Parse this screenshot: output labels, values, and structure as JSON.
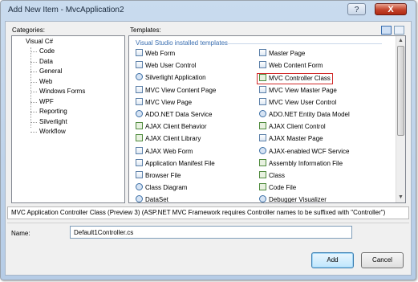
{
  "window": {
    "title": "Add New Item - MvcApplication2",
    "help_glyph": "?",
    "close_glyph": "X"
  },
  "categories": {
    "label": "Categories:",
    "root": "Visual C#",
    "items": [
      "Code",
      "Data",
      "General",
      "Web",
      "Windows Forms",
      "WPF",
      "Reporting",
      "Silverlight",
      "Workflow"
    ]
  },
  "templates": {
    "label": "Templates:",
    "group_header": "Visual Studio installed templates",
    "left": [
      {
        "label": "Web Form",
        "icon": "doc"
      },
      {
        "label": "Web User Control",
        "icon": "doc"
      },
      {
        "label": "Silverlight Application",
        "icon": "gear"
      },
      {
        "label": "MVC View Content Page",
        "icon": "doc"
      },
      {
        "label": "MVC View Page",
        "icon": "doc"
      },
      {
        "label": "ADO.NET Data Service",
        "icon": "gear"
      },
      {
        "label": "AJAX Client Behavior",
        "icon": "code"
      },
      {
        "label": "AJAX Client Library",
        "icon": "code"
      },
      {
        "label": "AJAX Web Form",
        "icon": "doc"
      },
      {
        "label": "Application Manifest File",
        "icon": "doc"
      },
      {
        "label": "Browser File",
        "icon": "doc"
      },
      {
        "label": "Class Diagram",
        "icon": "gear"
      },
      {
        "label": "DataSet",
        "icon": "gear"
      }
    ],
    "right": [
      {
        "label": "Master Page",
        "icon": "doc"
      },
      {
        "label": "Web Content Form",
        "icon": "doc"
      },
      {
        "label": "MVC Controller Class",
        "icon": "code",
        "selected": true
      },
      {
        "label": "MVC View Master Page",
        "icon": "doc"
      },
      {
        "label": "MVC View User Control",
        "icon": "doc"
      },
      {
        "label": "ADO.NET Entity Data Model",
        "icon": "gear"
      },
      {
        "label": "AJAX Client Control",
        "icon": "code"
      },
      {
        "label": "AJAX Master Page",
        "icon": "doc"
      },
      {
        "label": "AJAX-enabled WCF Service",
        "icon": "gear"
      },
      {
        "label": "Assembly Information File",
        "icon": "code"
      },
      {
        "label": "Class",
        "icon": "code"
      },
      {
        "label": "Code File",
        "icon": "code"
      },
      {
        "label": "Debugger Visualizer",
        "icon": "gear"
      }
    ],
    "scroll_up": "▲",
    "scroll_down": "▼"
  },
  "description": "MVC Application Controller Class (Preview 3) (ASP.NET MVC Framework requires Controller names to be suffixed with \"Controller\")",
  "name_field": {
    "label": "Name:",
    "value": "Default1Controller.cs"
  },
  "buttons": {
    "add": "Add",
    "cancel": "Cancel"
  }
}
